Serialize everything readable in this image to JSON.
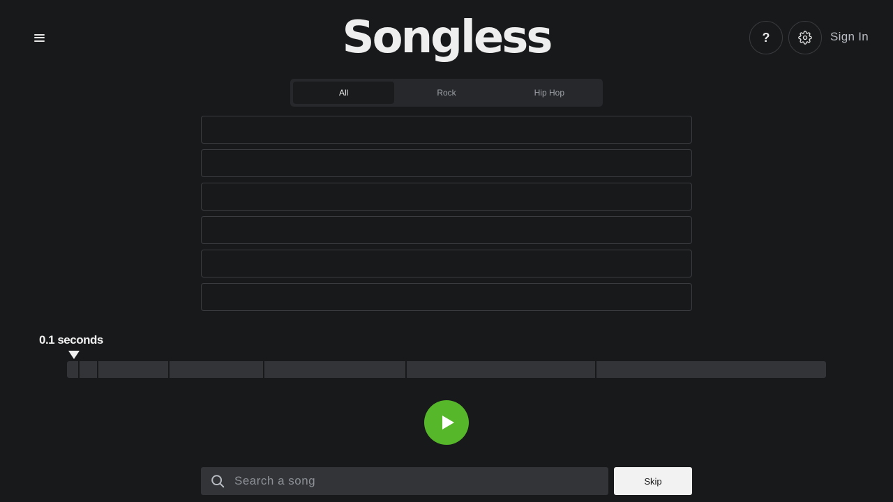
{
  "header": {
    "logo": "Songless",
    "help_label": "?",
    "signin_label": "Sign In",
    "icons": {
      "menu": "hamburger-icon",
      "settings": "gear-icon"
    }
  },
  "tabs": [
    {
      "label": "All",
      "active": true
    },
    {
      "label": "Rock",
      "active": false
    },
    {
      "label": "Hip Hop",
      "active": false
    }
  ],
  "guess_slots": 6,
  "timeline": {
    "label": "0.1 seconds",
    "segment_boundaries_seconds": [
      0.1,
      0.5,
      2,
      4,
      7,
      11,
      16
    ]
  },
  "player": {
    "icon": "play-icon",
    "accent": "#56b72b"
  },
  "search": {
    "placeholder": "Search a song",
    "value": "",
    "icon": "search-icon"
  },
  "skip_label": "Skip"
}
